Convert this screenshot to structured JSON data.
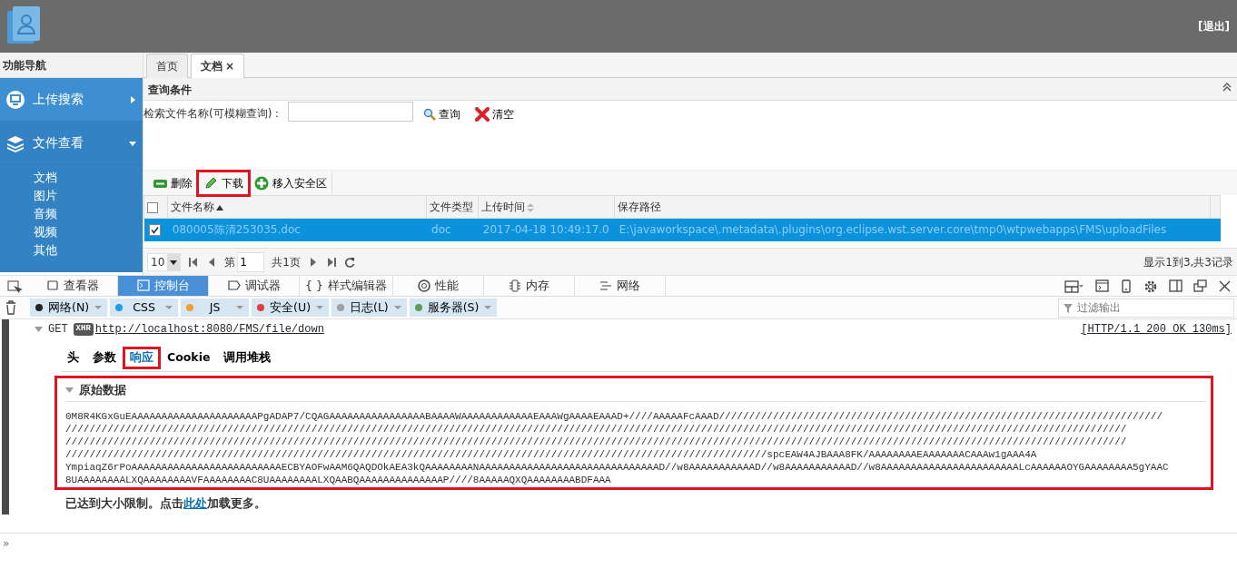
{
  "header": {
    "logout": "[退出]"
  },
  "sidebar": {
    "title": "功能导航",
    "menus": [
      {
        "label": "上传搜索",
        "kind": "monitor",
        "expanded": false
      },
      {
        "label": "文件查看",
        "kind": "layers",
        "expanded": true,
        "children": [
          {
            "label": "文档"
          },
          {
            "label": "图片"
          },
          {
            "label": "音频"
          },
          {
            "label": "视频"
          },
          {
            "label": "其他"
          }
        ]
      }
    ]
  },
  "tabs": [
    {
      "label": "首页",
      "selected": false,
      "closable": false
    },
    {
      "label": "文档",
      "selected": true,
      "closable": true,
      "close": "×"
    }
  ],
  "query": {
    "title": "查询条件",
    "label": "检索文件名称(可模糊查询)：",
    "search": "查询",
    "clear": "清空"
  },
  "toolbar": [
    {
      "label": "删除",
      "kind": "delete",
      "highlighted": false
    },
    {
      "label": "下载",
      "kind": "edit",
      "highlighted": true
    },
    {
      "label": "移入安全区",
      "kind": "add",
      "highlighted": false
    }
  ],
  "table": {
    "all_checked": false,
    "columns": [
      {
        "label": "文件名称",
        "sorted": true,
        "sortable": true
      },
      {
        "label": "文件类型",
        "sorted": false,
        "sortable": false
      },
      {
        "label": "上传时间",
        "sorted": false,
        "sortable": true
      },
      {
        "label": "保存路径",
        "sorted": false,
        "sortable": false
      }
    ],
    "rows": [
      {
        "selected": true,
        "checked": true,
        "cells": [
          "080005陈清253035.doc",
          "doc",
          "2017-04-18 10:49:17.0",
          "E:\\javaworkspace\\.metadata\\.plugins\\org.eclipse.wst.server.core\\tmp0\\wtpwebapps\\FMS\\uploadFiles"
        ]
      }
    ]
  },
  "pager": {
    "page_size": "10",
    "page_prefix": "第",
    "page": "1",
    "page_total": "共1页",
    "summary": "显示1到3,共3记录"
  },
  "devtools": {
    "tabs": [
      {
        "label": "查看器",
        "kind": "inspector",
        "selected": false
      },
      {
        "label": "控制台",
        "kind": "console",
        "selected": true
      },
      {
        "label": "调试器",
        "kind": "debugger",
        "selected": false
      },
      {
        "label": "样式编辑器",
        "kind": "style",
        "glyph": "{ }",
        "selected": false
      },
      {
        "label": "性能",
        "kind": "performance",
        "selected": false
      },
      {
        "label": "内存",
        "kind": "memory",
        "selected": false
      },
      {
        "label": "网络",
        "kind": "network",
        "selected": false
      }
    ],
    "filters": [
      {
        "label": "网络(N)",
        "color": "#222222"
      },
      {
        "label": "CSS",
        "color": "#1ea0e6"
      },
      {
        "label": "JS",
        "color": "#f0a030"
      },
      {
        "label": "安全(U)",
        "color": "#e23c3c"
      },
      {
        "label": "日志(L)",
        "color": "#a0a0a0"
      },
      {
        "label": "服务器(S)",
        "color": "#5c9e5c"
      }
    ],
    "filter_placeholder": "过滤输出",
    "request": {
      "method": "GET",
      "badge": "XHR",
      "url": "http://localhost:8080/FMS/file/down",
      "status": "[HTTP/1.1 200 OK 130ms]"
    },
    "subtabs": [
      {
        "label": "头",
        "selected": false,
        "highlighted": false
      },
      {
        "label": "参数",
        "selected": false,
        "highlighted": false
      },
      {
        "label": "响应",
        "selected": true,
        "highlighted": true
      },
      {
        "label": "Cookie",
        "selected": false,
        "highlighted": false
      },
      {
        "label": "调用堆栈",
        "selected": false,
        "highlighted": false
      }
    ],
    "raw": {
      "title": "原始数据",
      "highlighted": true,
      "lines": [
        "0M8R4KGxGuEAAAAAAAAAAAAAAAAAAAAAPgADAP7/CQAGAAAAAAAAAAAAAAAABAAAAWAAAAAAAAAAAAEAAAWgAAAAEAAAD+////AAAAAFcAAAD//////////////////////////////////////////////////////////////////////////",
        "/////////////////////////////////////////////////////////////////////////////////////////////////////////////////////////////////////////////////////////////////////////////////",
        "/////////////////////////////////////////////////////////////////////////////////////////////////////////////////////////////////////////////////////////////////////////////////",
        "/////////////////////////////////////////////////////////////////////////////////////////////////////////////////////spcEAW4AJBAAA8FK/AAAAAAAAEAAAAAAACAAAw1gAAA4A",
        "YmpiaqZ6rPoAAAAAAAAAAAAAAAAAAAAAAAAAECBYAOFwAAM6QAQDOkAEA3kQAAAAAAAANAAAAAAAAAAAAAAAAAAAAAAAAAAAAAAD//w8AAAAAAAAAAAD//w8AAAAAAAAAAAD//w8AAAAAAAAAAAAAAAAAAAAAAALcAAAAAAOYGAAAAAAAA5gYAAC",
        "8UAAAAAAAALXQAAAAAAAAVFAAAAAAAAC8UAAAAAAAALXQAABQAAAAAAAAAAAAAAP////8AAAAAQXQAAAAAAAABDFAAA"
      ]
    },
    "limit": {
      "before": "已达到大小限制。点击",
      "link": "此处",
      "after": "加载更多。"
    },
    "prompt": "»"
  }
}
